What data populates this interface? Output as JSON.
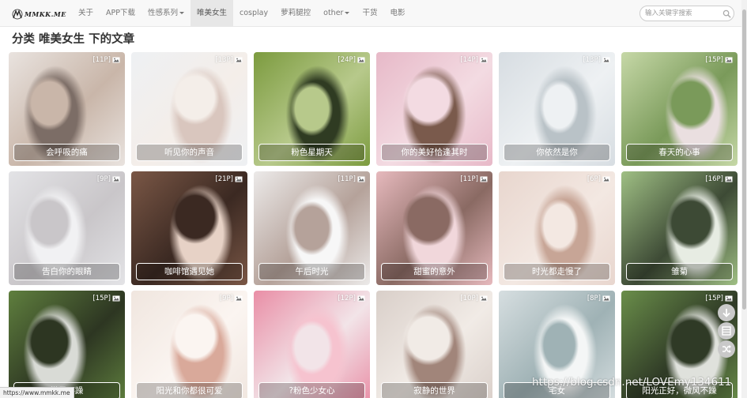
{
  "brand": {
    "name": "MMKK.ME"
  },
  "nav": {
    "items": [
      {
        "label": "关于",
        "dropdown": false,
        "active": false
      },
      {
        "label": "APP下载",
        "dropdown": false,
        "active": false
      },
      {
        "label": "性感系列",
        "dropdown": true,
        "active": false
      },
      {
        "label": "唯美女生",
        "dropdown": false,
        "active": true
      },
      {
        "label": "cosplay",
        "dropdown": false,
        "active": false
      },
      {
        "label": "萝莉腿控",
        "dropdown": false,
        "active": false
      },
      {
        "label": "other",
        "dropdown": true,
        "active": false
      },
      {
        "label": "干货",
        "dropdown": false,
        "active": false
      },
      {
        "label": "电影",
        "dropdown": false,
        "active": false
      }
    ]
  },
  "search": {
    "placeholder": "输入关键字搜索",
    "value": ""
  },
  "page": {
    "title": "分类 唯美女生 下的文章"
  },
  "cards": [
    {
      "title": "会呼吸的痛",
      "count": "[11P]",
      "colors": [
        "#e9e3df",
        "#7c6d66",
        "#c9b6a9"
      ]
    },
    {
      "title": "听见你的声音",
      "count": "[13P]",
      "colors": [
        "#eef0f3",
        "#d9c6be",
        "#f4eee9"
      ]
    },
    {
      "title": "粉色星期天",
      "count": "[24P]",
      "colors": [
        "#7c9b3f",
        "#2f3b22",
        "#b7c98b"
      ]
    },
    {
      "title": "你的美好恰逢其时",
      "count": "[14P]",
      "colors": [
        "#e7b9c8",
        "#7a5a4c",
        "#f3dbe2"
      ]
    },
    {
      "title": "你依然是你",
      "count": "[13P]",
      "colors": [
        "#d7dde2",
        "#b9c2c7",
        "#eef1f3"
      ]
    },
    {
      "title": "春天的心事",
      "count": "[15P]",
      "colors": [
        "#c6d8a7",
        "#eadfe0",
        "#7a9a5a"
      ]
    },
    {
      "title": "告白你的眼睛",
      "count": "[9P]",
      "colors": [
        "#e3e3e6",
        "#f1f1f3",
        "#c9c6c9"
      ]
    },
    {
      "title": "咖啡馆遇见她",
      "count": "[21P]",
      "colors": [
        "#7a5746",
        "#e7d2c6",
        "#3b2922"
      ]
    },
    {
      "title": "午后时光",
      "count": "[11P]",
      "colors": [
        "#eceae9",
        "#f7f7f7",
        "#b5a29a"
      ]
    },
    {
      "title": "甜蜜的意外",
      "count": "[11P]",
      "colors": [
        "#e6b9bd",
        "#f1d7db",
        "#8a6a63"
      ]
    },
    {
      "title": "时光都走慢了",
      "count": "[6P]",
      "colors": [
        "#e8d6ce",
        "#c7a596",
        "#f3e8e2"
      ]
    },
    {
      "title": "雏菊",
      "count": "[16P]",
      "colors": [
        "#9fbf84",
        "#e7ece3",
        "#3d4a35"
      ]
    },
    {
      "title": "微风不躁",
      "count": "[15P]",
      "colors": [
        "#5f7f3e",
        "#d9dbd6",
        "#2d3622"
      ]
    },
    {
      "title": "阳光和你都很可爱",
      "count": "[9P]",
      "colors": [
        "#f0e6df",
        "#d9a99a",
        "#fbf5f1"
      ]
    },
    {
      "title": "?粉色少女心",
      "count": "[12P]",
      "colors": [
        "#e98ea6",
        "#f6c3cf",
        "#f2e4e8"
      ]
    },
    {
      "title": "寂静的世界",
      "count": "[10P]",
      "colors": [
        "#d9cfc9",
        "#a1857a",
        "#f1ebe6"
      ]
    },
    {
      "title": "宅女",
      "count": "[8P]",
      "colors": [
        "#d6dee0",
        "#f4f6f6",
        "#9fb2b5"
      ]
    },
    {
      "title": "阳光正好，微风不躁",
      "count": "[15P]",
      "colors": [
        "#6a8e4a",
        "#dfe1dc",
        "#2f3a26"
      ]
    }
  ],
  "float_buttons": [
    {
      "icon": "arrow-down-icon"
    },
    {
      "icon": "qrcode-icon"
    },
    {
      "icon": "shuffle-icon"
    }
  ],
  "status_url": "https://www.mmkk.me",
  "watermark": "https://blog.csdn.net/LOVEmy134611"
}
